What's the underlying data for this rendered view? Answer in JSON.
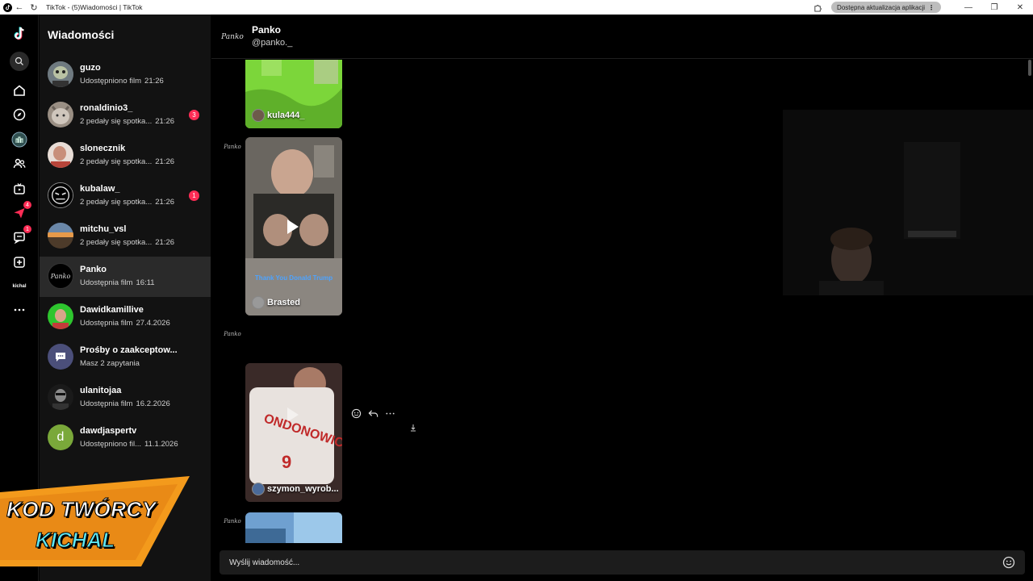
{
  "window": {
    "title": "TikTok - (5)Wiadomości | TikTok",
    "update_label": "Dostępna aktualizacja aplikacji"
  },
  "rail": {
    "profile_label": "kichal",
    "messages_badge": "4",
    "inbox_badge": "1"
  },
  "sidebar": {
    "title": "Wiadomości",
    "conversations": [
      {
        "name": "guzo",
        "sub": "Udostępniono film",
        "time": "21:26",
        "badge": ""
      },
      {
        "name": "ronaldinio3_",
        "sub": "2 pedały się spotka...",
        "time": "21:26",
        "badge": "3"
      },
      {
        "name": "slonecznik",
        "sub": "2 pedały się spotka...",
        "time": "21:26",
        "badge": ""
      },
      {
        "name": "kubalaw_",
        "sub": "2 pedały się spotka...",
        "time": "21:26",
        "badge": "1"
      },
      {
        "name": "mitchu_vsl",
        "sub": "2 pedały się spotka...",
        "time": "21:26",
        "badge": ""
      },
      {
        "name": "Panko",
        "sub": "Udostępnia film",
        "time": "16:11",
        "badge": ""
      },
      {
        "name": "Dawidkamillive",
        "sub": "Udostępnia film",
        "time": "27.4.2026",
        "badge": ""
      },
      {
        "name": "Prośby o zaakceptow...",
        "sub": "Masz 2 zapytania",
        "time": "",
        "badge": ""
      },
      {
        "name": "ulanitojaa",
        "sub": "Udostępnia film",
        "time": "16.2.2026",
        "badge": ""
      },
      {
        "name": "dawdjaspertv",
        "sub": "Udostępniono fil...",
        "time": "11.1.2026",
        "badge": ""
      }
    ]
  },
  "promo": {
    "line1": "KOD TWÓRCY",
    "line2": "KICHAL"
  },
  "chat": {
    "name": "Panko",
    "handle": "@panko._",
    "avatar_text": "Panko",
    "videos": [
      {
        "author": "kula444_",
        "caption": ""
      },
      {
        "author": "Brasted",
        "caption": "Thank You Donald Trump"
      },
      {
        "author": "szymon_wyrob...",
        "caption": ""
      }
    ],
    "composer_placeholder": "Wyślij wiadomość..."
  },
  "colors": {
    "accent": "#fe2c55",
    "background": "#000000",
    "sidebar": "#121212",
    "promo_orange": "#f39a1c",
    "promo_cyan": "#5ee6f2"
  }
}
